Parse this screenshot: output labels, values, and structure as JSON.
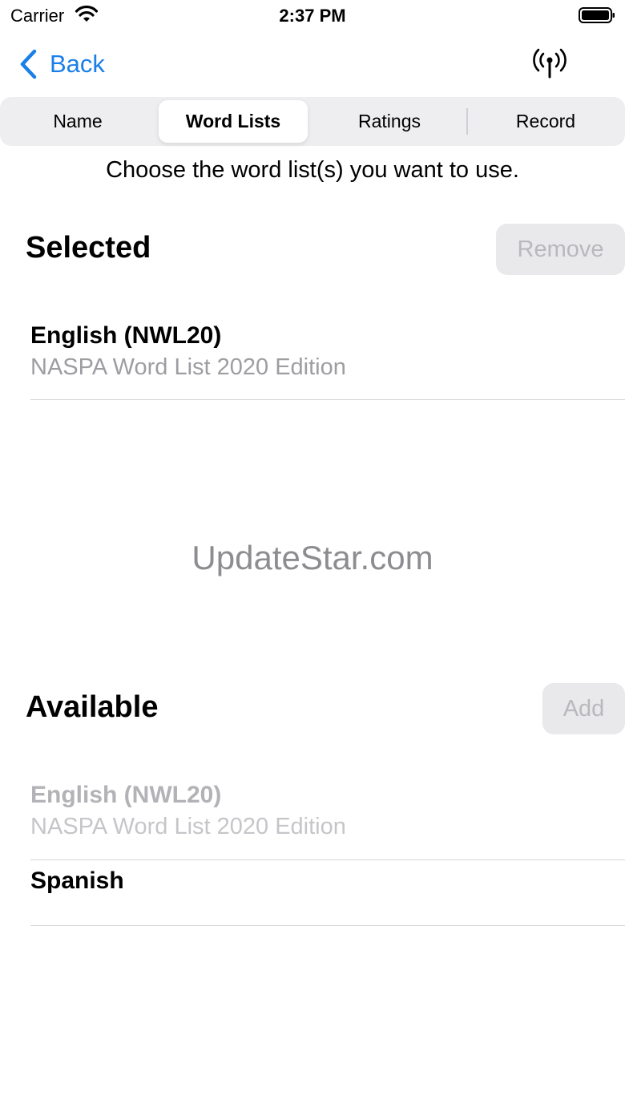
{
  "status": {
    "carrier": "Carrier",
    "time": "2:37 PM"
  },
  "nav": {
    "back_label": "Back",
    "right_icon": "antenna-broadcast-icon"
  },
  "tabs": [
    {
      "label": "Name"
    },
    {
      "label": "Word Lists",
      "selected": true
    },
    {
      "label": "Ratings"
    },
    {
      "label": "Record"
    }
  ],
  "instruction": "Choose the word list(s) you want to use.",
  "selected_section": {
    "title": "Selected",
    "button_label": "Remove",
    "items": [
      {
        "name": "English (NWL20)",
        "description": "NASPA Word List 2020 Edition"
      }
    ]
  },
  "watermark": "UpdateStar.com",
  "available_section": {
    "title": "Available",
    "button_label": "Add",
    "items": [
      {
        "name": "English (NWL20)",
        "description": "NASPA Word List 2020 Edition",
        "disabled": true
      },
      {
        "name": "Spanish"
      }
    ]
  },
  "colors": {
    "accent": "#1a7fe8",
    "segment_bg": "#eeeef0",
    "disabled_button_bg": "#e9e9eb"
  }
}
